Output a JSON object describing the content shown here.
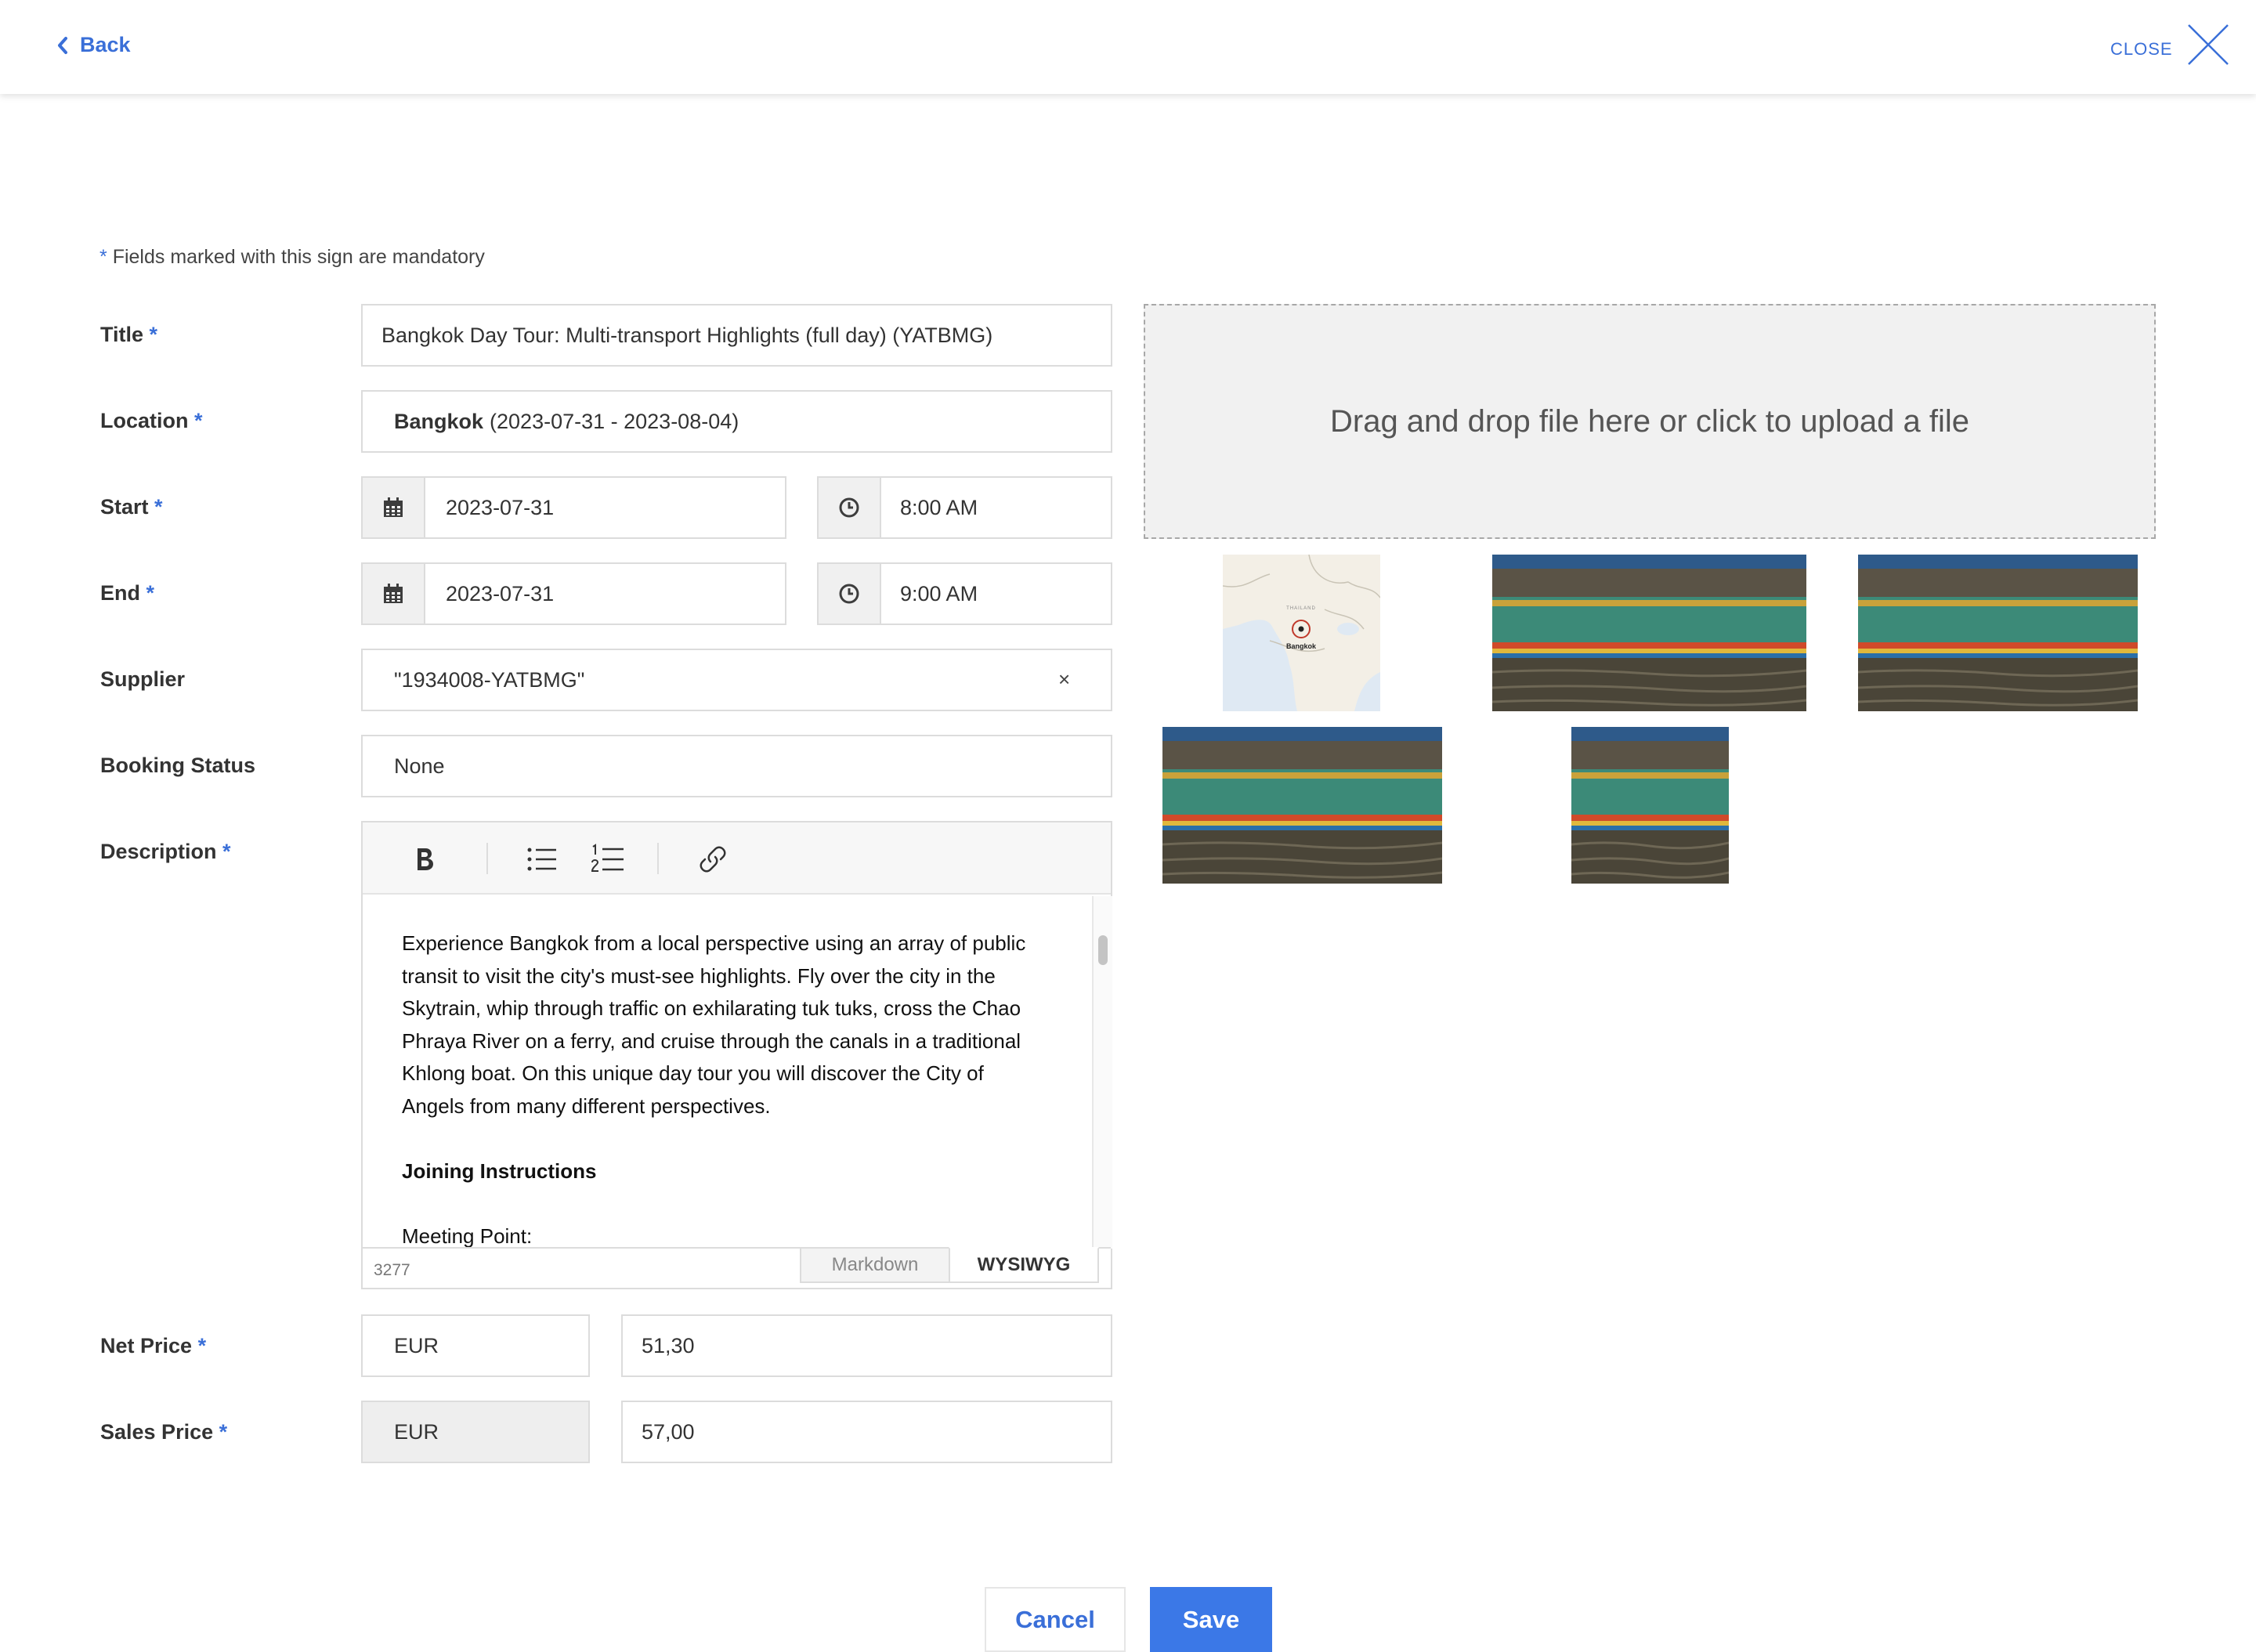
{
  "header": {
    "back_label": "Back",
    "close_label": "CLOSE"
  },
  "form": {
    "mandatory_star": "*",
    "mandatory_note": "Fields marked with this sign are mandatory",
    "title": {
      "label": "Title",
      "value": "Bangkok Day Tour: Multi-transport Highlights (full day) (YATBMG)"
    },
    "location": {
      "label": "Location",
      "name": "Bangkok",
      "dates": "(2023-07-31 - 2023-08-04)"
    },
    "start": {
      "label": "Start",
      "date": "2023-07-31",
      "time": "8:00 AM"
    },
    "end": {
      "label": "End",
      "date": "2023-07-31",
      "time": "9:00 AM"
    },
    "supplier": {
      "label": "Supplier",
      "value": "\"1934008-YATBMG\"",
      "clear": "×"
    },
    "booking_status": {
      "label": "Booking Status",
      "value": "None"
    },
    "description": {
      "label": "Description",
      "paragraph1": "Experience Bangkok from a local perspective using an array of public transit to visit the city's must-see highlights. Fly over the city in the Skytrain, whip through traffic on exhilarating tuk tuks, cross the Chao Phraya River on a ferry, and cruise through the canals in a traditional Khlong boat. On this unique day tour you will discover the City of Angels from many different perspectives.",
      "heading": "Joining Instructions",
      "paragraph2": "Meeting Point:",
      "char_count": "3277",
      "mode_markdown": "Markdown",
      "mode_wysiwyg": "WYSIWYG",
      "active_mode": "WYSIWYG"
    },
    "net_price": {
      "label": "Net Price",
      "currency": "EUR",
      "amount": "51,30"
    },
    "sales_price": {
      "label": "Sales Price",
      "currency": "EUR",
      "amount": "57,00"
    }
  },
  "upload": {
    "dropzone_text": "Drag and drop file here or click to upload a file",
    "map_country": "THAILAND",
    "map_city": "Bangkok"
  },
  "actions": {
    "cancel_label": "Cancel",
    "save_label": "Save"
  },
  "colors": {
    "accent": "#3a6fd8",
    "save_button": "#3b78e7"
  }
}
